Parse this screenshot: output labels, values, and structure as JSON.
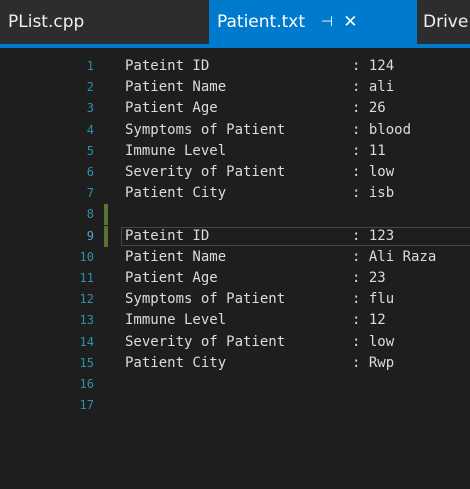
{
  "tabs": [
    {
      "label": "PList.cpp"
    },
    {
      "label": "Patient.txt",
      "pin_glyph": "⊣",
      "close_glyph": "✕"
    },
    {
      "label": "Drive"
    }
  ],
  "colors": {
    "editor_bg": "#1e1e1e",
    "tabbar_bg": "#2d2d30",
    "active_tab": "#007acc",
    "line_number": "#2b91af",
    "text": "#dcdcdc",
    "modified_marker": "#577430"
  },
  "lines": [
    {
      "num": "1",
      "key": "Pateint ID",
      "val": ": 124"
    },
    {
      "num": "2",
      "key": "Patient Name",
      "val": ": ali"
    },
    {
      "num": "3",
      "key": "Patient Age",
      "val": ": 26"
    },
    {
      "num": "4",
      "key": "Symptoms of Patient",
      "val": ": blood"
    },
    {
      "num": "5",
      "key": "Immune Level",
      "val": ": 11"
    },
    {
      "num": "6",
      "key": "Severity of Patient",
      "val": ": low"
    },
    {
      "num": "7",
      "key": "Patient City",
      "val": ": isb"
    },
    {
      "num": "8",
      "key": "",
      "val": ""
    },
    {
      "num": "9",
      "key": "Pateint ID",
      "val": ": 123"
    },
    {
      "num": "10",
      "key": "Patient Name",
      "val": ": Ali Raza"
    },
    {
      "num": "11",
      "key": "Patient Age",
      "val": ": 23"
    },
    {
      "num": "12",
      "key": "Symptoms of Patient",
      "val": ": flu"
    },
    {
      "num": "13",
      "key": "Immune Level",
      "val": ": 12"
    },
    {
      "num": "14",
      "key": "Severity of Patient",
      "val": ": low"
    },
    {
      "num": "15",
      "key": "Patient City",
      "val": ": Rwp"
    },
    {
      "num": "16",
      "key": "",
      "val": ""
    },
    {
      "num": "17",
      "key": "",
      "val": ""
    }
  ]
}
